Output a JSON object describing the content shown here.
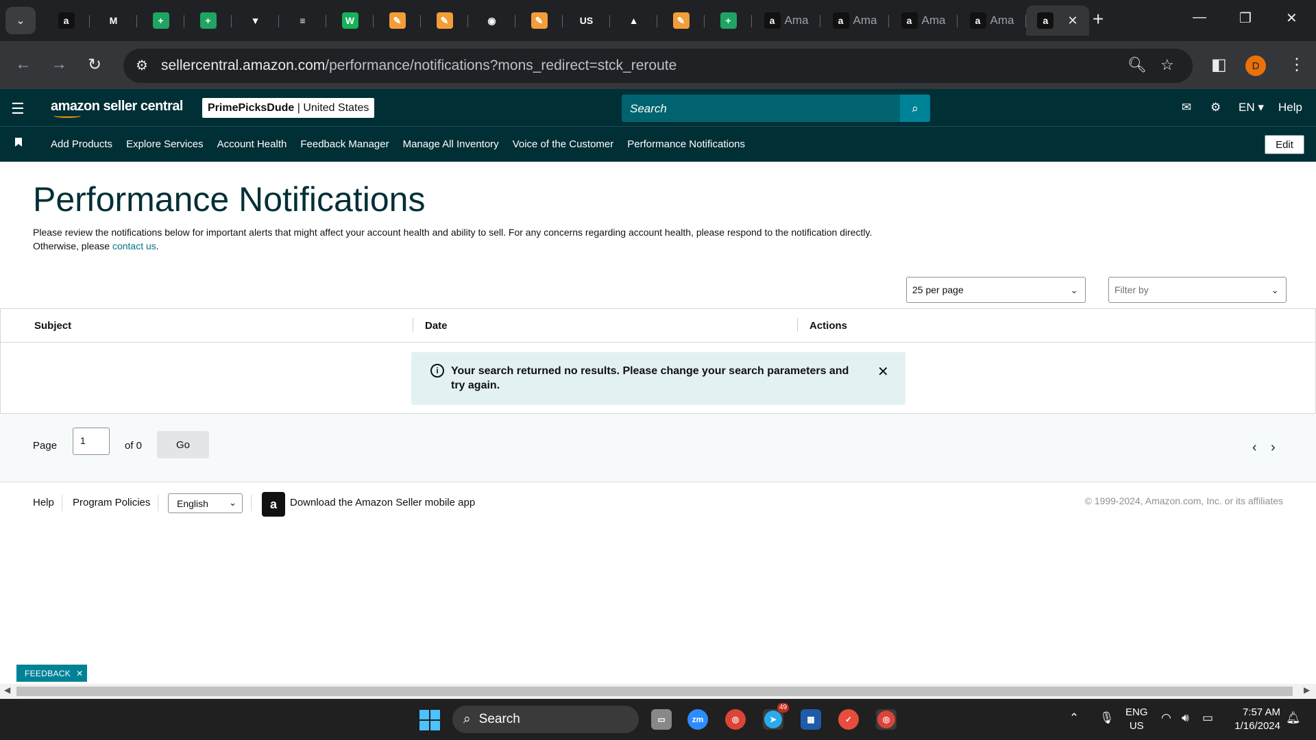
{
  "browser": {
    "tabs": [
      {
        "icon": "amazon-icon",
        "glyph": "a",
        "bg": "#111111",
        "label": ""
      },
      {
        "icon": "gmail-icon",
        "glyph": "M",
        "bg": "#202124",
        "label": ""
      },
      {
        "icon": "sheets-plus-icon",
        "glyph": "+",
        "bg": "#1fa463",
        "label": ""
      },
      {
        "icon": "sheets-plus-icon",
        "glyph": "+",
        "bg": "#1fa463",
        "label": ""
      },
      {
        "icon": "shield-red-icon",
        "glyph": "▼",
        "bg": "#202124",
        "label": ""
      },
      {
        "icon": "brand-icon",
        "glyph": "≡",
        "bg": "#202124",
        "label": ""
      },
      {
        "icon": "w-icon",
        "glyph": "W",
        "bg": "#16b159",
        "label": ""
      },
      {
        "icon": "stripe-tool-icon",
        "glyph": "✎",
        "bg": "#f29d38",
        "label": ""
      },
      {
        "icon": "stripe-tool-icon",
        "glyph": "✎",
        "bg": "#f29d38",
        "label": ""
      },
      {
        "icon": "circle-logo-icon",
        "glyph": "◉",
        "bg": "#202124",
        "label": ""
      },
      {
        "icon": "stripe-tool-icon",
        "glyph": "✎",
        "bg": "#f29d38",
        "label": ""
      },
      {
        "icon": "us-foods-icon",
        "glyph": "US",
        "bg": "#202124",
        "label": ""
      },
      {
        "icon": "drive-icon",
        "glyph": "▲",
        "bg": "#202124",
        "label": ""
      },
      {
        "icon": "stripe-tool-icon",
        "glyph": "✎",
        "bg": "#f29d38",
        "label": ""
      },
      {
        "icon": "sheets-plus-icon",
        "glyph": "+",
        "bg": "#1fa463",
        "label": ""
      },
      {
        "icon": "amazon-icon",
        "glyph": "a",
        "bg": "#111111",
        "label": "Ama"
      },
      {
        "icon": "amazon-icon",
        "glyph": "a",
        "bg": "#111111",
        "label": "Ama"
      },
      {
        "icon": "amazon-icon",
        "glyph": "a",
        "bg": "#111111",
        "label": "Ama"
      },
      {
        "icon": "amazon-icon",
        "glyph": "a",
        "bg": "#111111",
        "label": "Ama"
      }
    ],
    "active_tab_icon": "a",
    "url_host": "sellercentral.amazon.com",
    "url_path": "/performance/notifications?mons_redirect=stck_reroute",
    "profile_initial": "D"
  },
  "header": {
    "logo_text": "amazon seller central",
    "store_name": "PrimePicksDude",
    "store_region": "United States",
    "search_placeholder": "Search",
    "language": "EN",
    "help": "Help"
  },
  "nav": {
    "links": [
      "Add Products",
      "Explore Services",
      "Account Health",
      "Feedback Manager",
      "Manage All Inventory",
      "Voice of the Customer",
      "Performance Notifications"
    ],
    "edit": "Edit"
  },
  "page": {
    "title": "Performance Notifications",
    "intro_line": "Please review the notifications below for important alerts that might affect your account health and ability to sell. For any concerns regarding account health, please respond to the notification directly. Otherwise, please ",
    "contact_link": "contact us",
    "per_page": "25 per page",
    "filter_placeholder": "Filter by",
    "columns": [
      "Subject",
      "Date",
      "Actions"
    ],
    "alert_text": "Your search returned no results. Please change your search parameters and try again.",
    "pager": {
      "page_label": "Page",
      "page_value": "1",
      "of_label": "of 0",
      "go": "Go"
    }
  },
  "footer": {
    "help": "Help",
    "policies": "Program Policies",
    "language": "English",
    "app_download": "Download the Amazon Seller mobile app",
    "copyright": "© 1999-2024, Amazon.com, Inc. or its affiliates"
  },
  "feedback_label": "FEEDBACK",
  "taskbar": {
    "search": "Search",
    "telegram_badge": "49",
    "lang_top": "ENG",
    "lang_bottom": "US",
    "time": "7:57 AM",
    "date": "1/16/2024"
  },
  "colors": {
    "header_bg": "#002f36",
    "search_bg": "#00636f",
    "search_btn": "#008296",
    "link": "#007185",
    "alert_bg": "#e3f1f2"
  }
}
